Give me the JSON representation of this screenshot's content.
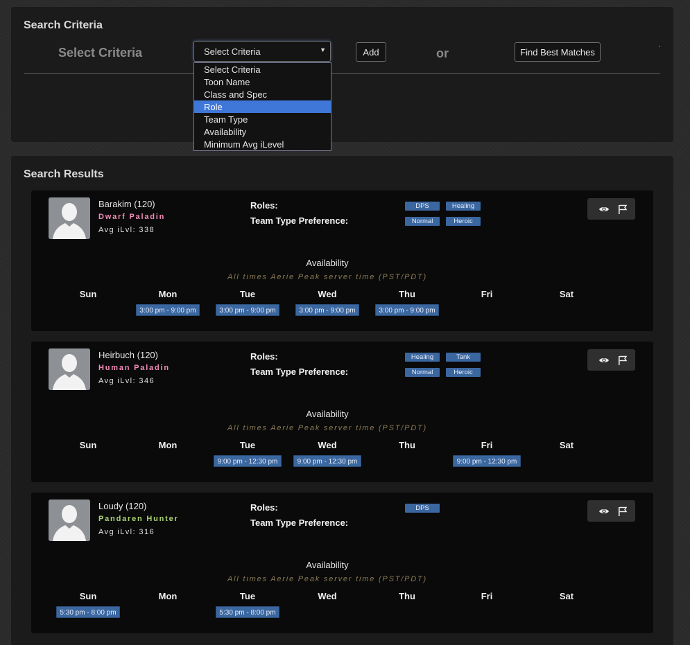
{
  "search_criteria": {
    "title": "Search Criteria",
    "label": "Select Criteria",
    "select_value": "Select Criteria",
    "add_label": "Add",
    "or_label": "or",
    "find_label": "Find Best Matches",
    "dropdown_options": [
      "Select Criteria",
      "Toon Name",
      "Class and Spec",
      "Role",
      "Team Type",
      "Availability",
      "Minimum Avg iLevel"
    ],
    "highlighted_option": "Role"
  },
  "search_results": {
    "title": "Search Results",
    "roles_label": "Roles:",
    "team_type_label": "Team Type Preference:",
    "availability_title": "Availability",
    "availability_note": "All times Aerie Peak server time (PST/PDT)",
    "days": [
      "Sun",
      "Mon",
      "Tue",
      "Wed",
      "Thu",
      "Fri",
      "Sat"
    ],
    "results": [
      {
        "name": "Barakim (120)",
        "class": "Dwarf Paladin",
        "class_color": "#f58cba",
        "ilvl": "Avg iLvl: 338",
        "roles": [
          "DPS",
          "Healing"
        ],
        "team_types": [
          "Normal",
          "Heroic"
        ],
        "slots": [
          {
            "day": "Mon",
            "text": "3:00 pm - 9:00 pm"
          },
          {
            "day": "Tue",
            "text": "3:00 pm - 9:00 pm"
          },
          {
            "day": "Wed",
            "text": "3:00 pm - 9:00 pm"
          },
          {
            "day": "Thu",
            "text": "3:00 pm - 9:00 pm"
          }
        ]
      },
      {
        "name": "Heirbuch (120)",
        "class": "Human Paladin",
        "class_color": "#f58cba",
        "ilvl": "Avg iLvl: 346",
        "roles": [
          "Healing",
          "Tank"
        ],
        "team_types": [
          "Normal",
          "Heroic"
        ],
        "slots": [
          {
            "day": "Tue",
            "text": "9:00 pm - 12:30 pm"
          },
          {
            "day": "Wed",
            "text": "9:00 pm - 12:30 pm"
          },
          {
            "day": "Fri",
            "text": "9:00 pm - 12:30 pm"
          }
        ]
      },
      {
        "name": "Loudy (120)",
        "class": "Pandaren Hunter",
        "class_color": "#abd473",
        "ilvl": "Avg iLvl: 316",
        "roles": [
          "DPS"
        ],
        "team_types": [],
        "slots": [
          {
            "day": "Sun",
            "text": "5:30 pm - 8:00 pm"
          },
          {
            "day": "Tue",
            "text": "5:30 pm - 8:00 pm"
          }
        ]
      }
    ]
  },
  "icons": {
    "view": "eye-icon",
    "report": "flag-icon",
    "dropdown_arrow": "caret-down-icon",
    "avatar": "avatar-silhouette-icon"
  }
}
